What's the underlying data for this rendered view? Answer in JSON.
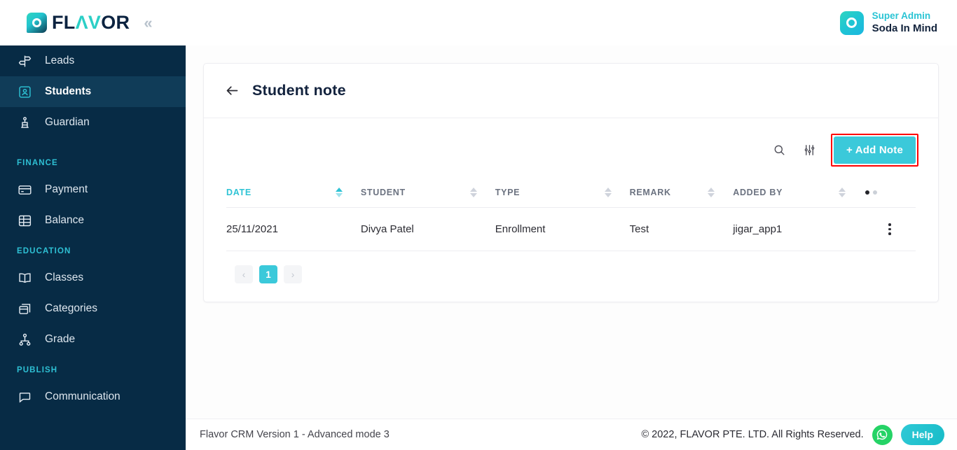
{
  "topbar": {
    "logo_dark_1": "FL",
    "logo_teal": "ΛV",
    "logo_dark_2": "OR",
    "collapse_label": "«",
    "collapse_icon": "chevron-double-left-icon",
    "logo_icon": "flavor-logo-mark",
    "user": {
      "role": "Super Admin",
      "name": "Soda In Mind",
      "avatar_icon": "user-avatar-icon"
    }
  },
  "sidebar": {
    "items": [
      {
        "label": "Leads",
        "icon": "signpost-icon",
        "active": false
      },
      {
        "label": "Students",
        "icon": "student-badge-icon",
        "active": true
      },
      {
        "label": "Guardian",
        "icon": "guardian-icon",
        "active": false
      }
    ],
    "sections": [
      {
        "title": "FINANCE",
        "items": [
          {
            "label": "Payment",
            "icon": "credit-card-icon"
          },
          {
            "label": "Balance",
            "icon": "balance-sheet-icon"
          }
        ]
      },
      {
        "title": "EDUCATION",
        "items": [
          {
            "label": "Classes",
            "icon": "open-book-icon"
          },
          {
            "label": "Categories",
            "icon": "boxes-icon"
          },
          {
            "label": "Grade",
            "icon": "hierarchy-icon"
          }
        ]
      },
      {
        "title": "PUBLISH",
        "items": [
          {
            "label": "Communication",
            "icon": "chat-bubble-icon"
          }
        ]
      }
    ]
  },
  "page": {
    "title": "Student note",
    "back_icon": "arrow-left-icon"
  },
  "toolbar": {
    "search_icon": "search-icon",
    "filter_icon": "filter-sliders-icon",
    "add_note_label": "+ Add Note",
    "highlight_color": "#ff0000",
    "primary_color": "#3bc9da"
  },
  "table": {
    "columns": [
      {
        "key": "date",
        "label": "DATE",
        "sorted": true
      },
      {
        "key": "student",
        "label": "STUDENT",
        "sorted": false
      },
      {
        "key": "type",
        "label": "TYPE",
        "sorted": false
      },
      {
        "key": "remark",
        "label": "REMARK",
        "sorted": false
      },
      {
        "key": "added_by",
        "label": "ADDED BY",
        "sorted": false
      }
    ],
    "rows": [
      {
        "date": "25/11/2021",
        "student": "Divya Patel",
        "type": "Enrollment",
        "remark": "Test",
        "added_by": "jigar_app1",
        "menu_icon": "kebab-menu-icon"
      }
    ]
  },
  "pagination": {
    "prev_label": "‹",
    "next_label": "›",
    "current_page": "1"
  },
  "footer": {
    "version": "Flavor CRM Version 1 - Advanced mode 3",
    "copyright": "© 2022, FLAVOR PTE. LTD. All Rights Reserved.",
    "whatsapp_icon": "whatsapp-icon",
    "help_label": "Help"
  }
}
